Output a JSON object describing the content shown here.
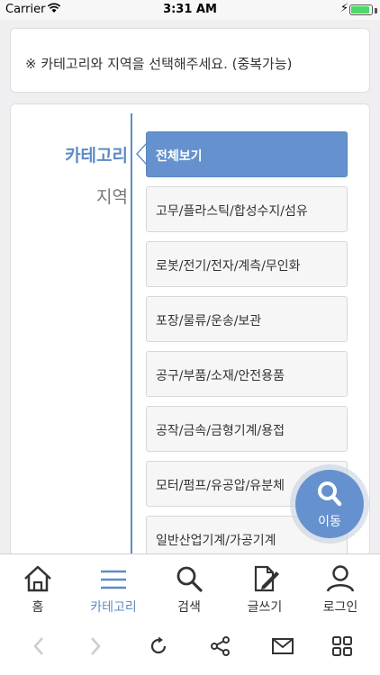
{
  "status_bar": {
    "carrier": "Carrier",
    "time": "3:31 AM",
    "battery_level": 0.9,
    "battery_color": "#4cd964"
  },
  "notice": {
    "text": "※ 카테고리와 지역을 선택해주세요. (중복가능)"
  },
  "tabs": [
    {
      "label": "카테고리",
      "active": true
    },
    {
      "label": "지역",
      "active": false
    }
  ],
  "categories": [
    {
      "label": "전체보기",
      "selected": true
    },
    {
      "label": "고무/플라스틱/합성수지/섬유",
      "selected": false
    },
    {
      "label": "로봇/전기/전자/계측/무인화",
      "selected": false
    },
    {
      "label": "포장/물류/운송/보관",
      "selected": false
    },
    {
      "label": "공구/부품/소재/안전용품",
      "selected": false
    },
    {
      "label": "공작/금속/금형기계/용접",
      "selected": false
    },
    {
      "label": "모터/펌프/유공압/유분체",
      "selected": false
    },
    {
      "label": "일반산업기계/가공기계",
      "selected": false
    }
  ],
  "fab": {
    "label": "이동",
    "icon": "search-icon"
  },
  "bottom_nav": [
    {
      "label": "홈",
      "icon": "home-icon",
      "active": false
    },
    {
      "label": "카테고리",
      "icon": "menu-icon",
      "active": true
    },
    {
      "label": "검색",
      "icon": "search-icon",
      "active": false
    },
    {
      "label": "글쓰기",
      "icon": "write-icon",
      "active": false
    },
    {
      "label": "로그인",
      "icon": "user-icon",
      "active": false
    }
  ],
  "browser_bar": [
    {
      "icon": "back-icon",
      "enabled": false
    },
    {
      "icon": "forward-icon",
      "enabled": false
    },
    {
      "icon": "reload-icon",
      "enabled": true
    },
    {
      "icon": "share-icon",
      "enabled": true
    },
    {
      "icon": "mail-icon",
      "enabled": true
    },
    {
      "icon": "grid-icon",
      "enabled": true
    }
  ],
  "colors": {
    "accent": "#5e8bc7",
    "selected_bg": "#6592ce"
  }
}
